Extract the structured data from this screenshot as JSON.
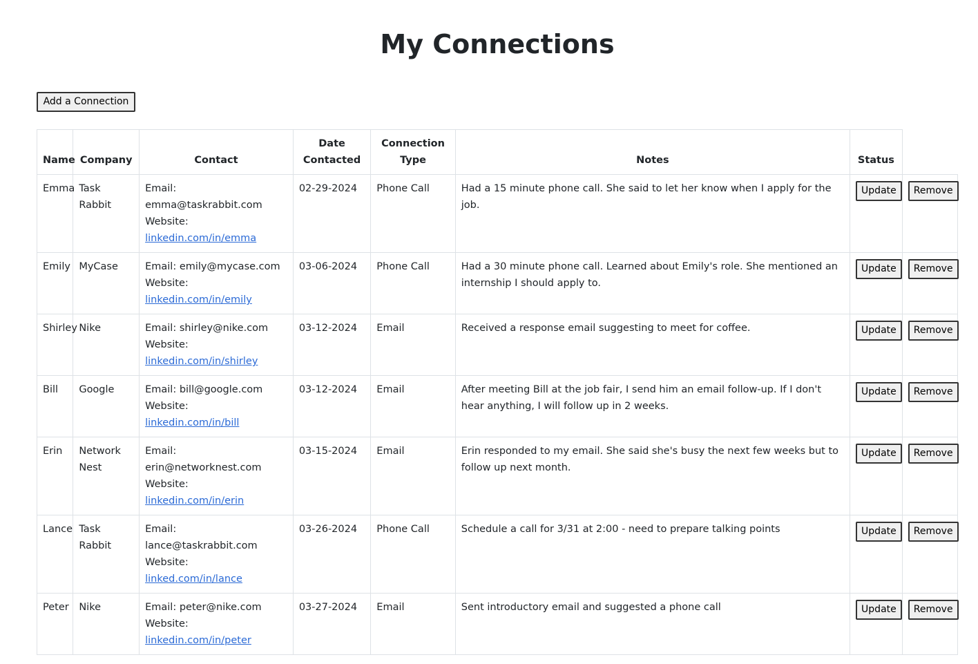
{
  "page": {
    "title": "My Connections",
    "add_button": "Add a Connection"
  },
  "table": {
    "headers": {
      "name": "Name",
      "company": "Company",
      "contact": "Contact",
      "date": "Date Contacted",
      "type": "Connection Type",
      "notes": "Notes",
      "status": "Status",
      "remove": ""
    },
    "rows": [
      {
        "name": "Emma",
        "company": "Task Rabbit",
        "email_label": "Email: emma@taskrabbit.com",
        "website_label": "Website:",
        "website": "linkedin.com/in/emma",
        "date": "02-29-2024",
        "type": "Phone Call",
        "notes": "Had a 15 minute phone call. She said to let her know when I apply for the job.",
        "update": "Update",
        "remove": "Remove"
      },
      {
        "name": "Emily",
        "company": "MyCase",
        "email_label": "Email: emily@mycase.com",
        "website_label": "Website:",
        "website": "linkedin.com/in/emily",
        "date": "03-06-2024",
        "type": "Phone Call",
        "notes": "Had a 30 minute phone call. Learned about Emily's role. She mentioned an internship I should apply to.",
        "update": "Update",
        "remove": "Remove"
      },
      {
        "name": "Shirley",
        "company": "Nike",
        "email_label": "Email: shirley@nike.com",
        "website_label": "Website:",
        "website": "linkedin.com/in/shirley",
        "date": "03-12-2024",
        "type": "Email",
        "notes": "Received a response email suggesting to meet for coffee.",
        "update": "Update",
        "remove": "Remove"
      },
      {
        "name": "Bill",
        "company": "Google",
        "email_label": "Email: bill@google.com",
        "website_label": "Website:",
        "website": "linkedin.com/in/bill",
        "date": "03-12-2024",
        "type": "Email",
        "notes": "After meeting Bill at the job fair, I send him an email follow-up. If I don't hear anything, I will follow up in 2 weeks.",
        "update": "Update",
        "remove": "Remove"
      },
      {
        "name": "Erin",
        "company": "Network Nest",
        "email_label": "Email: erin@networknest.com",
        "website_label": "Website:",
        "website": "linkedin.com/in/erin",
        "date": "03-15-2024",
        "type": "Email",
        "notes": "Erin responded to my email. She said she's busy the next few weeks but to follow up next month.",
        "update": "Update",
        "remove": "Remove"
      },
      {
        "name": "Lance",
        "company": "Task Rabbit",
        "email_label": "Email: lance@taskrabbit.com",
        "website_label": "Website:",
        "website": "linked.com/in/lance",
        "date": "03-26-2024",
        "type": "Phone Call",
        "notes": "Schedule a call for 3/31 at 2:00 - need to prepare talking points",
        "update": "Update",
        "remove": "Remove"
      },
      {
        "name": "Peter",
        "company": "Nike",
        "email_label": "Email: peter@nike.com",
        "website_label": "Website:",
        "website": "linkedin.com/in/peter",
        "date": "03-27-2024",
        "type": "Email",
        "notes": "Sent introductory email and suggested a phone call",
        "update": "Update",
        "remove": "Remove"
      }
    ]
  }
}
